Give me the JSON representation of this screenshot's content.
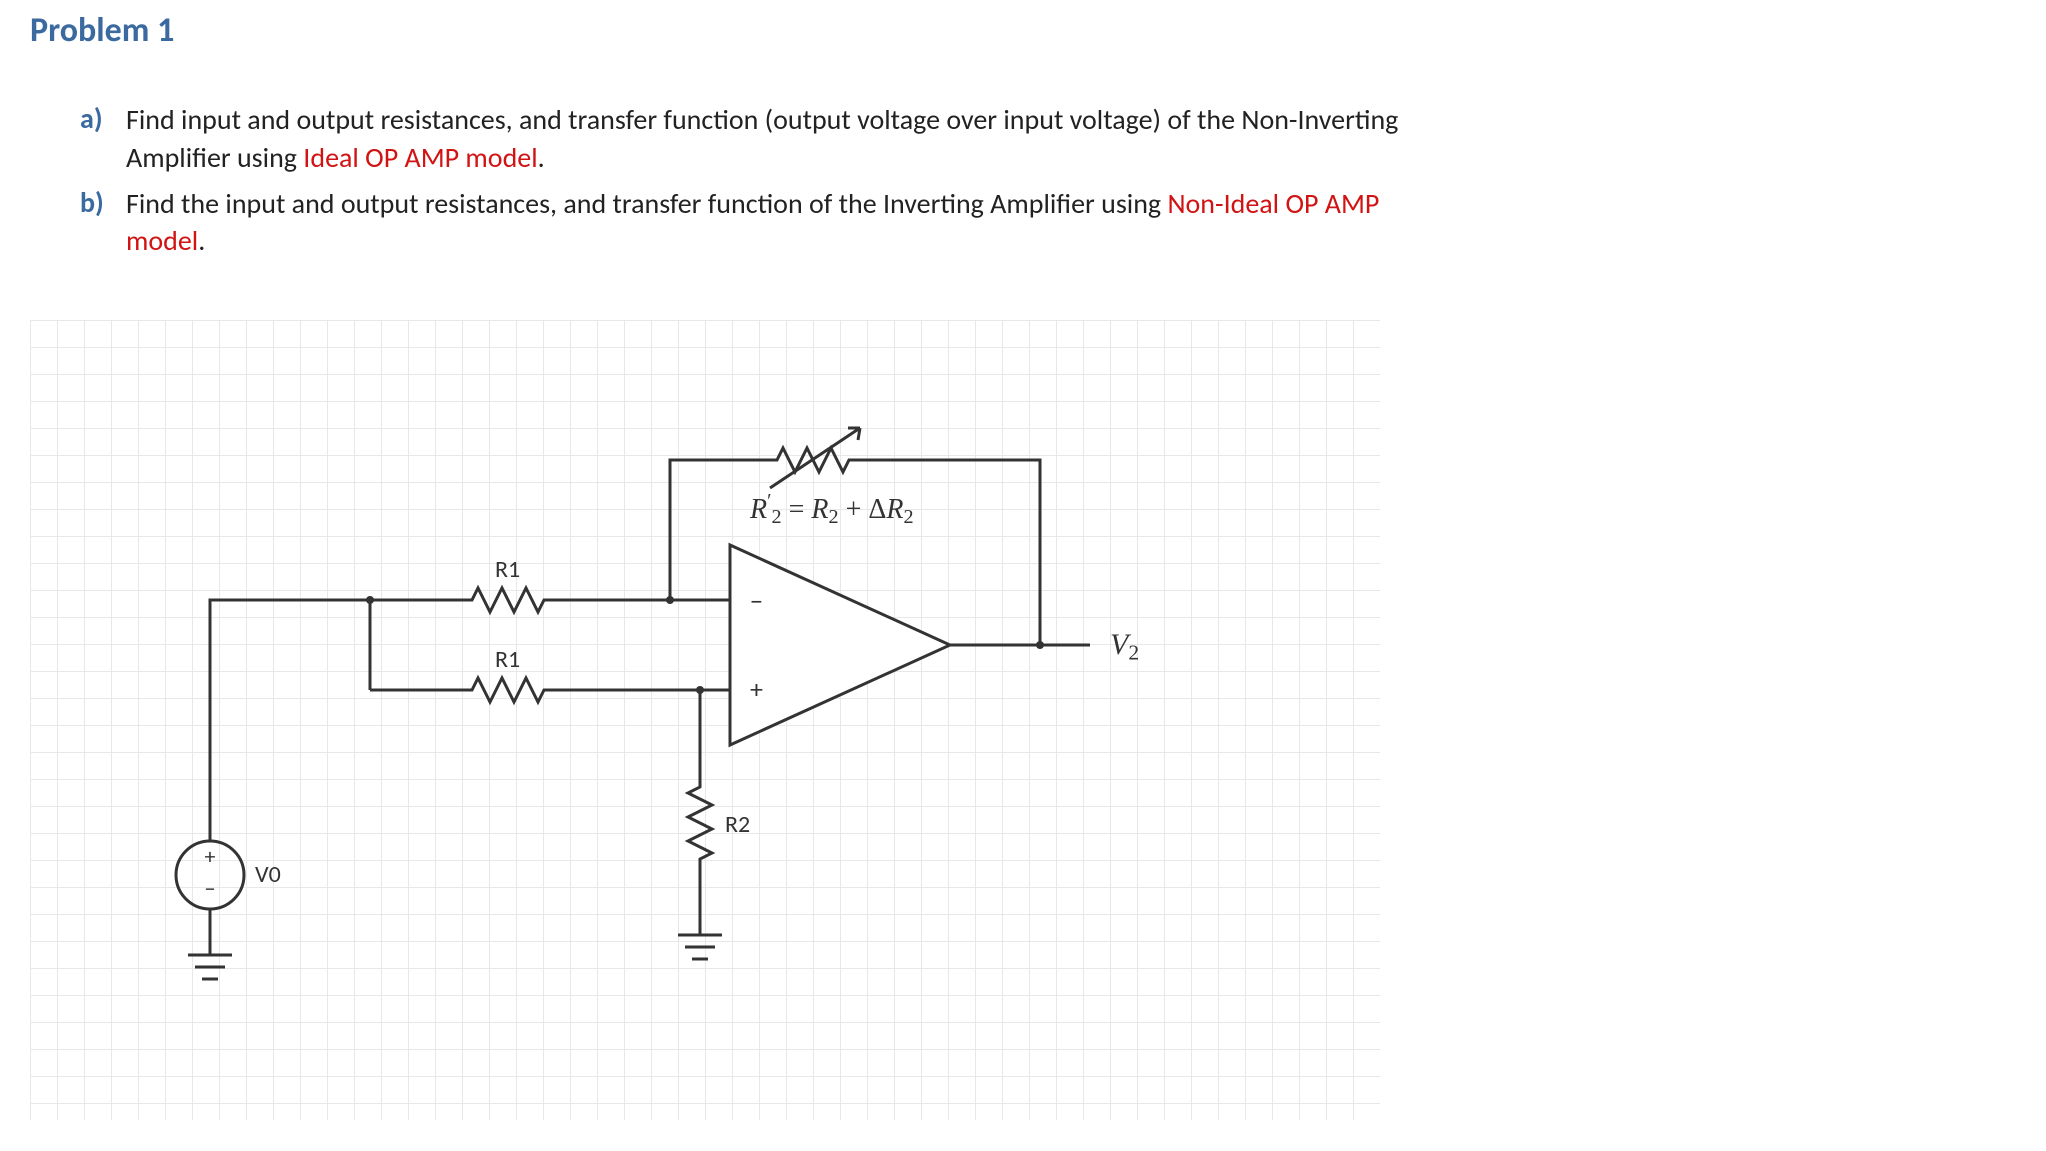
{
  "title": "Problem 1",
  "items": [
    {
      "marker": "a)",
      "pre": "Find input and output resistances, and transfer function (output voltage over input voltage) of the Non-Inverting Amplifier using ",
      "highlight": "Ideal OP AMP model",
      "post": "."
    },
    {
      "marker": "b)",
      "pre": "Find the input and output resistances, and transfer function of the Inverting Amplifier using ",
      "highlight": "Non-Ideal OP AMP model",
      "post": "."
    }
  ],
  "circuit": {
    "source_label": "V0",
    "r1_top": "R1",
    "r1_bottom": "R1",
    "r2_ground": "R2",
    "feedback_equation": "R′₂ = R₂ + ΔR₂",
    "feedback_equation_parts": {
      "lhs_base": "R",
      "lhs_prime": "′",
      "lhs_sub": "2",
      "eq": " = ",
      "t1_base": "R",
      "t1_sub": "2",
      "plus": " + Δ",
      "t2_base": "R",
      "t2_sub": "2"
    },
    "output_label_parts": {
      "base": "V",
      "sub": "2"
    },
    "opamp_minus": "−",
    "opamp_plus": "+",
    "source_plus": "+",
    "source_minus": "−"
  }
}
